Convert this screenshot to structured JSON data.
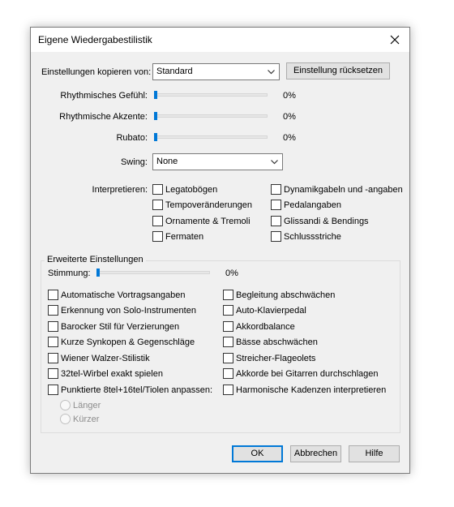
{
  "window": {
    "title": "Eigene Wiedergabestilistik"
  },
  "copy": {
    "label": "Einstellungen kopieren von:",
    "value": "Standard",
    "reset_label": "Einstellung rücksetzen"
  },
  "sliders": [
    {
      "label": "Rhythmisches Gefühl:",
      "value": "0%",
      "level": 0
    },
    {
      "label": "Rhythmische Akzente:",
      "value": "0%",
      "level": 0
    },
    {
      "label": "Rubato:",
      "value": "0%",
      "level": 0
    }
  ],
  "swing": {
    "label": "Swing:",
    "value": "None"
  },
  "interpret": {
    "label": "Interpretieren:",
    "items": [
      "Legatobögen",
      "Tempoveränderungen",
      "Ornamente & Tremoli",
      "Fermaten",
      "Dynamikgabeln und -angaben",
      "Pedalangaben",
      "Glissandi & Bendings",
      "Schlussstriche"
    ]
  },
  "advanced": {
    "title": "Erweiterte Einstellungen",
    "tuning_label": "Stimmung:",
    "tuning_value": "0%",
    "tuning_level": 0,
    "left_items": [
      "Automatische Vortragsangaben",
      "Erkennung von Solo-Instrumenten",
      "Barocker Stil für Verzierungen",
      "Kurze Synkopen & Gegenschläge",
      "Wiener Walzer-Stilistik",
      "32tel-Wirbel exakt spielen",
      "Punktierte 8tel+16tel/Tiolen anpassen:"
    ],
    "right_items": [
      "Begleitung abschwächen",
      "Auto-Klavierpedal",
      "Akkordbalance",
      "Bässe abschwächen",
      "Streicher-Flageolets",
      "Akkorde bei Gitarren durchschlagen",
      "Harmonische Kadenzen interpretieren"
    ],
    "radios": [
      "Länger",
      "Kürzer"
    ]
  },
  "buttons": {
    "ok": "OK",
    "cancel": "Abbrechen",
    "help": "Hilfe"
  }
}
